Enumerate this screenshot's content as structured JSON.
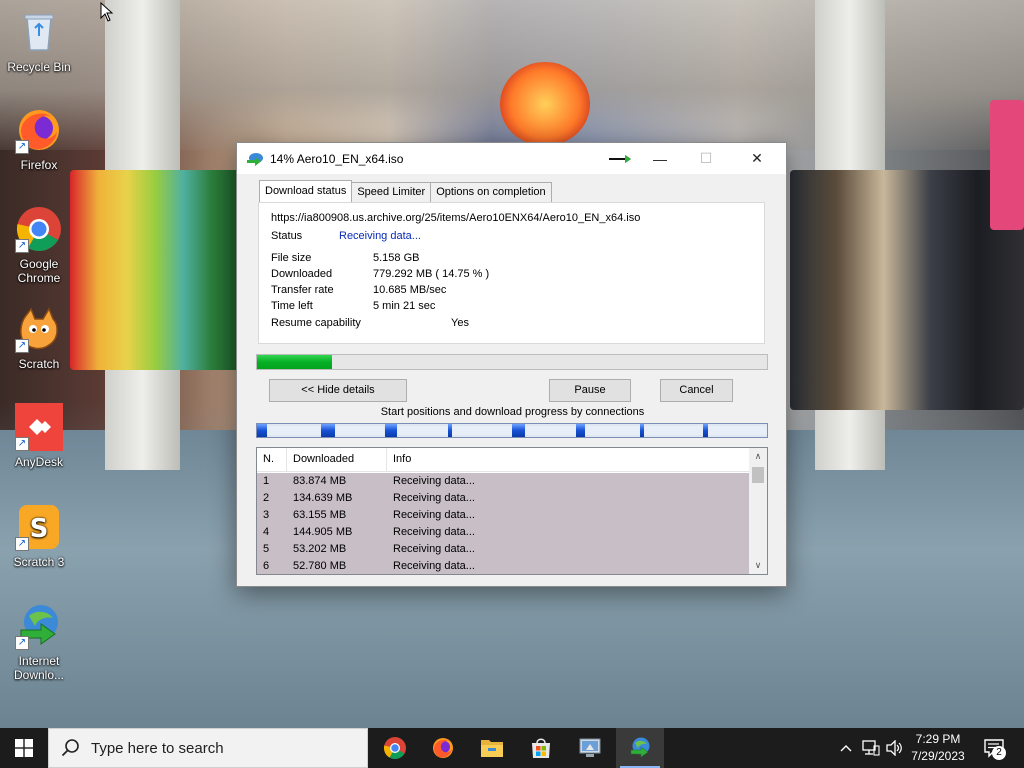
{
  "desktop": {
    "icons": [
      {
        "label": "Recycle Bin",
        "icon": "recycle-bin-icon"
      },
      {
        "label": "Firefox",
        "icon": "firefox-icon"
      },
      {
        "label": "Google Chrome",
        "icon": "chrome-icon"
      },
      {
        "label": "Scratch",
        "icon": "scratch-icon"
      },
      {
        "label": "AnyDesk",
        "icon": "anydesk-icon"
      },
      {
        "label": "Scratch 3",
        "icon": "scratch3-icon"
      },
      {
        "label": "Internet Downlo...",
        "icon": "idm-icon"
      }
    ]
  },
  "dialog": {
    "title": "14% Aero10_EN_x64.iso",
    "tabs": [
      "Download status",
      "Speed Limiter",
      "Options on completion"
    ],
    "active_tab": "Download status",
    "url": "https://ia800908.us.archive.org/25/items/Aero10ENX64/Aero10_EN_x64.iso",
    "status_label": "Status",
    "status_value": "Receiving data...",
    "file_size_label": "File size",
    "file_size_value": "5.158  GB",
    "downloaded_label": "Downloaded",
    "downloaded_value": "779.292  MB  ( 14.75 % )",
    "transfer_rate_label": "Transfer rate",
    "transfer_rate_value": "10.685  MB/sec",
    "time_left_label": "Time left",
    "time_left_value": "5 min 21 sec",
    "resume_label": "Resume capability",
    "resume_value": "Yes",
    "progress_percent": 14.75,
    "buttons": {
      "hide_details": "<< Hide details",
      "pause": "Pause",
      "cancel": "Cancel"
    },
    "connections_caption": "Start positions and download progress by connections",
    "connections_progress": [
      0.15,
      0.22,
      0.2,
      0.05,
      0.2,
      0.15,
      0.06,
      0.08
    ],
    "columns": [
      "N.",
      "Downloaded",
      "Info"
    ],
    "rows": [
      {
        "n": "1",
        "downloaded": "83.874  MB",
        "info": "Receiving data..."
      },
      {
        "n": "2",
        "downloaded": "134.639  MB",
        "info": "Receiving data..."
      },
      {
        "n": "3",
        "downloaded": "63.155  MB",
        "info": "Receiving data..."
      },
      {
        "n": "4",
        "downloaded": "144.905  MB",
        "info": "Receiving data..."
      },
      {
        "n": "5",
        "downloaded": "53.202  MB",
        "info": "Receiving data..."
      },
      {
        "n": "6",
        "downloaded": "52.780  MB",
        "info": "Receiving data..."
      }
    ]
  },
  "taskbar": {
    "search_placeholder": "Type here to search",
    "apps": [
      "chrome-icon",
      "firefox-icon",
      "file-explorer-icon",
      "microsoft-store-icon",
      "control-panel-icon",
      "idm-icon"
    ],
    "time": "7:29 PM",
    "date": "7/29/2023",
    "notification_count": "2",
    "colors": {
      "accent": "#8ab6f5",
      "progress": "#06b025",
      "status_text": "#0a2ab7"
    }
  }
}
